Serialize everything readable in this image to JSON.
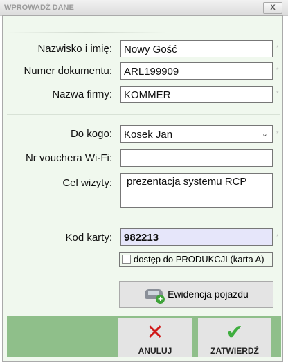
{
  "window": {
    "title": "WPROWADŹ DANE",
    "close_label": "X"
  },
  "form": {
    "name": {
      "label": "Nazwisko i imię:",
      "value": "Nowy Gość"
    },
    "document": {
      "label": "Numer dokumentu:",
      "value": "ARL199909"
    },
    "company": {
      "label": "Nazwa firmy:",
      "value": "KOMMER"
    },
    "to_whom": {
      "label": "Do kogo:",
      "value": "Kosek Jan"
    },
    "voucher": {
      "label": "Nr vouchera Wi-Fi:",
      "value": ""
    },
    "purpose": {
      "label": "Cel wizyty:",
      "value": "prezentacja systemu RCP"
    },
    "card": {
      "label": "Kod karty:",
      "value": "982213"
    },
    "production_access": {
      "label": "dostęp do PRODUKCJI (karta A)",
      "checked": false
    },
    "required_mark": "*"
  },
  "buttons": {
    "vehicle": "Ewidencja pojazdu",
    "cancel": "ANULUJ",
    "confirm": "ZATWIERDŹ"
  }
}
